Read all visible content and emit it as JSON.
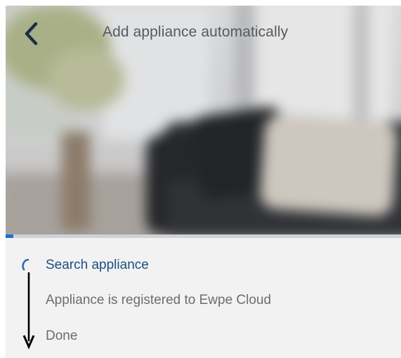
{
  "header": {
    "title": "Add appliance automatically",
    "back_icon": "chevron-left-icon"
  },
  "progress": {
    "value_percent": 2,
    "color": "#1f6fcc"
  },
  "steps": [
    {
      "label": "Search appliance",
      "state": "in-progress"
    },
    {
      "label": "Appliance is registered to Ewpe Cloud",
      "state": "pending"
    },
    {
      "label": "Done",
      "state": "pending"
    }
  ],
  "icons": {
    "spinner": "loading-spinner-icon",
    "arrow": "arrow-down-icon"
  },
  "colors": {
    "active_step": "#1c4f86",
    "pending_step": "#6d6d6d",
    "panel_background": "#f2f2f2"
  }
}
